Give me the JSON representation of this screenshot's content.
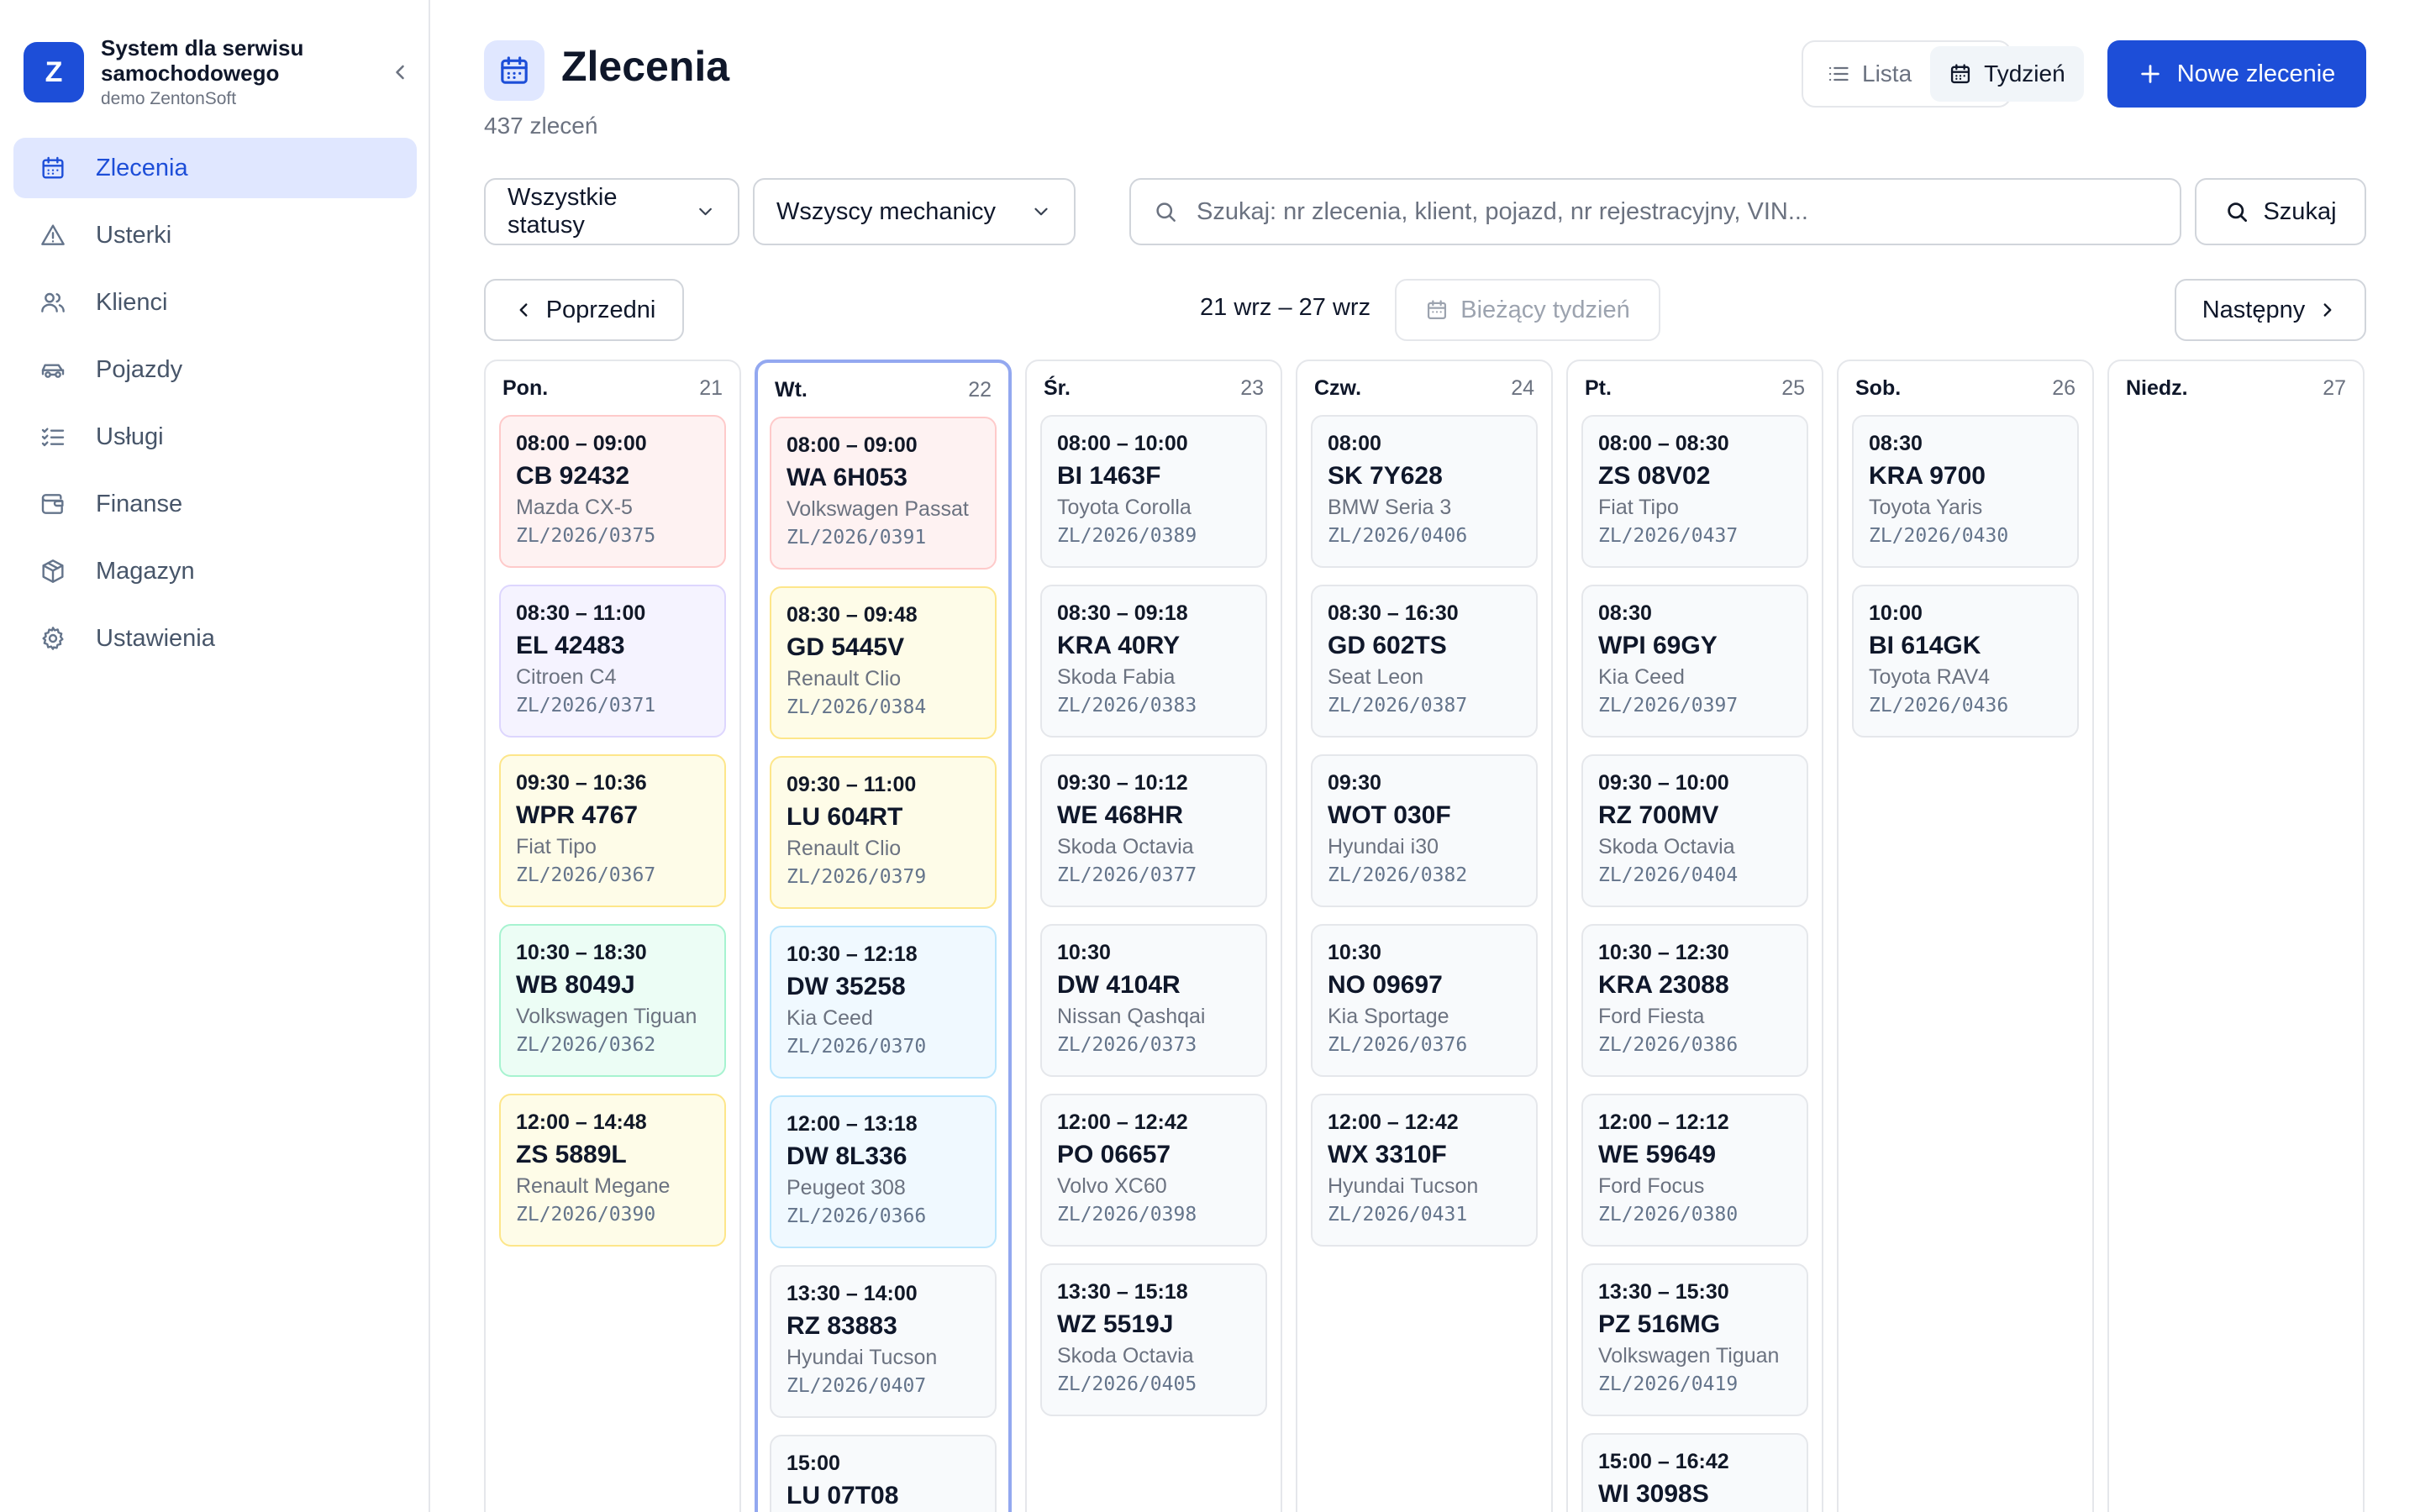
{
  "brand": {
    "initial": "Z",
    "title": "System dla serwisu samochodowego",
    "subtitle": "demo ZentonSoft"
  },
  "sidebar": {
    "items": [
      {
        "label": "Zlecenia",
        "icon": "calendar-icon",
        "active": true
      },
      {
        "label": "Usterki",
        "icon": "warning-icon"
      },
      {
        "label": "Klienci",
        "icon": "users-icon"
      },
      {
        "label": "Pojazdy",
        "icon": "car-icon"
      },
      {
        "label": "Usługi",
        "icon": "checklist-icon"
      },
      {
        "label": "Finanse",
        "icon": "wallet-icon"
      },
      {
        "label": "Magazyn",
        "icon": "package-icon"
      },
      {
        "label": "Ustawienia",
        "icon": "gear-icon"
      }
    ]
  },
  "header": {
    "title": "Zlecenia",
    "count": "437 zleceń",
    "view_list": "Lista",
    "view_week": "Tydzień",
    "new_order": "Nowe zlecenie"
  },
  "filters": {
    "status": "Wszystkie statusy",
    "mechanic": "Wszyscy mechanicy",
    "search_placeholder": "Szukaj: nr zlecenia, klient, pojazd, nr rejestracyjny, VIN...",
    "search_button": "Szukaj"
  },
  "week_nav": {
    "prev": "Poprzedni",
    "range": "21 wrz – 27 wrz",
    "current": "Bieżący tydzień",
    "next": "Następny"
  },
  "colors": {
    "accent": "#1d4ed8",
    "today_border": "#93a8f0"
  },
  "days": [
    {
      "name": "Pon.",
      "num": "21",
      "cards": [
        {
          "time": "08:00 – 09:00",
          "plate": "CB 92432",
          "car": "Mazda CX-5",
          "no": "ZL/2026/0375",
          "color": "red"
        },
        {
          "time": "08:30 – 11:00",
          "plate": "EL 42483",
          "car": "Citroen C4",
          "no": "ZL/2026/0371",
          "color": "purple"
        },
        {
          "time": "09:30 – 10:36",
          "plate": "WPR 4767",
          "car": "Fiat Tipo",
          "no": "ZL/2026/0367",
          "color": "yellow"
        },
        {
          "time": "10:30 – 18:30",
          "plate": "WB 8049J",
          "car": "Volkswagen Tiguan",
          "no": "ZL/2026/0362",
          "color": "green"
        },
        {
          "time": "12:00 – 14:48",
          "plate": "ZS 5889L",
          "car": "Renault Megane",
          "no": "ZL/2026/0390",
          "color": "yellow"
        }
      ]
    },
    {
      "name": "Wt.",
      "num": "22",
      "today": true,
      "cards": [
        {
          "time": "08:00 – 09:00",
          "plate": "WA 6H053",
          "car": "Volkswagen Passat",
          "no": "ZL/2026/0391",
          "color": "red"
        },
        {
          "time": "08:30 – 09:48",
          "plate": "GD 5445V",
          "car": "Renault Clio",
          "no": "ZL/2026/0384",
          "color": "yellow"
        },
        {
          "time": "09:30 – 11:00",
          "plate": "LU 604RT",
          "car": "Renault Clio",
          "no": "ZL/2026/0379",
          "color": "yellow"
        },
        {
          "time": "10:30 – 12:18",
          "plate": "DW 35258",
          "car": "Kia Ceed",
          "no": "ZL/2026/0370",
          "color": "blue"
        },
        {
          "time": "12:00 – 13:18",
          "plate": "DW 8L336",
          "car": "Peugeot 308",
          "no": "ZL/2026/0366",
          "color": "blue"
        },
        {
          "time": "13:30 – 14:00",
          "plate": "RZ 83883",
          "car": "Hyundai Tucson",
          "no": "ZL/2026/0407",
          "color": "gray"
        },
        {
          "time": "15:00",
          "plate": "LU 07T08",
          "car": "",
          "no": "",
          "color": "gray"
        }
      ]
    },
    {
      "name": "Śr.",
      "num": "23",
      "cards": [
        {
          "time": "08:00 – 10:00",
          "plate": "BI 1463F",
          "car": "Toyota Corolla",
          "no": "ZL/2026/0389",
          "color": "gray"
        },
        {
          "time": "08:30 – 09:18",
          "plate": "KRA 40RY",
          "car": "Skoda Fabia",
          "no": "ZL/2026/0383",
          "color": "gray"
        },
        {
          "time": "09:30 – 10:12",
          "plate": "WE 468HR",
          "car": "Skoda Octavia",
          "no": "ZL/2026/0377",
          "color": "gray"
        },
        {
          "time": "10:30",
          "plate": "DW 4104R",
          "car": "Nissan Qashqai",
          "no": "ZL/2026/0373",
          "color": "gray"
        },
        {
          "time": "12:00 – 12:42",
          "plate": "PO 06657",
          "car": "Volvo XC60",
          "no": "ZL/2026/0398",
          "color": "gray"
        },
        {
          "time": "13:30 – 15:18",
          "plate": "WZ 5519J",
          "car": "Skoda Octavia",
          "no": "ZL/2026/0405",
          "color": "gray"
        }
      ]
    },
    {
      "name": "Czw.",
      "num": "24",
      "cards": [
        {
          "time": "08:00",
          "plate": "SK 7Y628",
          "car": "BMW Seria 3",
          "no": "ZL/2026/0406",
          "color": "gray"
        },
        {
          "time": "08:30 – 16:30",
          "plate": "GD 602TS",
          "car": "Seat Leon",
          "no": "ZL/2026/0387",
          "color": "gray"
        },
        {
          "time": "09:30",
          "plate": "WOT 030F",
          "car": "Hyundai i30",
          "no": "ZL/2026/0382",
          "color": "gray"
        },
        {
          "time": "10:30",
          "plate": "NO 09697",
          "car": "Kia Sportage",
          "no": "ZL/2026/0376",
          "color": "gray"
        },
        {
          "time": "12:00 – 12:42",
          "plate": "WX 3310F",
          "car": "Hyundai Tucson",
          "no": "ZL/2026/0431",
          "color": "gray"
        }
      ]
    },
    {
      "name": "Pt.",
      "num": "25",
      "cards": [
        {
          "time": "08:00 – 08:30",
          "plate": "ZS 08V02",
          "car": "Fiat Tipo",
          "no": "ZL/2026/0437",
          "color": "gray"
        },
        {
          "time": "08:30",
          "plate": "WPI 69GY",
          "car": "Kia Ceed",
          "no": "ZL/2026/0397",
          "color": "gray"
        },
        {
          "time": "09:30 – 10:00",
          "plate": "RZ 700MV",
          "car": "Skoda Octavia",
          "no": "ZL/2026/0404",
          "color": "gray"
        },
        {
          "time": "10:30 – 12:30",
          "plate": "KRA 23088",
          "car": "Ford Fiesta",
          "no": "ZL/2026/0386",
          "color": "gray"
        },
        {
          "time": "12:00 – 12:12",
          "plate": "WE 59649",
          "car": "Ford Focus",
          "no": "ZL/2026/0380",
          "color": "gray"
        },
        {
          "time": "13:30 – 15:30",
          "plate": "PZ 516MG",
          "car": "Volkswagen Tiguan",
          "no": "ZL/2026/0419",
          "color": "gray"
        },
        {
          "time": "15:00 – 16:42",
          "plate": "WI 3098S",
          "car": "",
          "no": "",
          "color": "gray"
        }
      ]
    },
    {
      "name": "Sob.",
      "num": "26",
      "cards": [
        {
          "time": "08:30",
          "plate": "KRA 9700",
          "car": "Toyota Yaris",
          "no": "ZL/2026/0430",
          "color": "gray"
        },
        {
          "time": "10:00",
          "plate": "BI 614GK",
          "car": "Toyota RAV4",
          "no": "ZL/2026/0436",
          "color": "gray"
        }
      ]
    },
    {
      "name": "Niedz.",
      "num": "27",
      "cards": []
    }
  ]
}
